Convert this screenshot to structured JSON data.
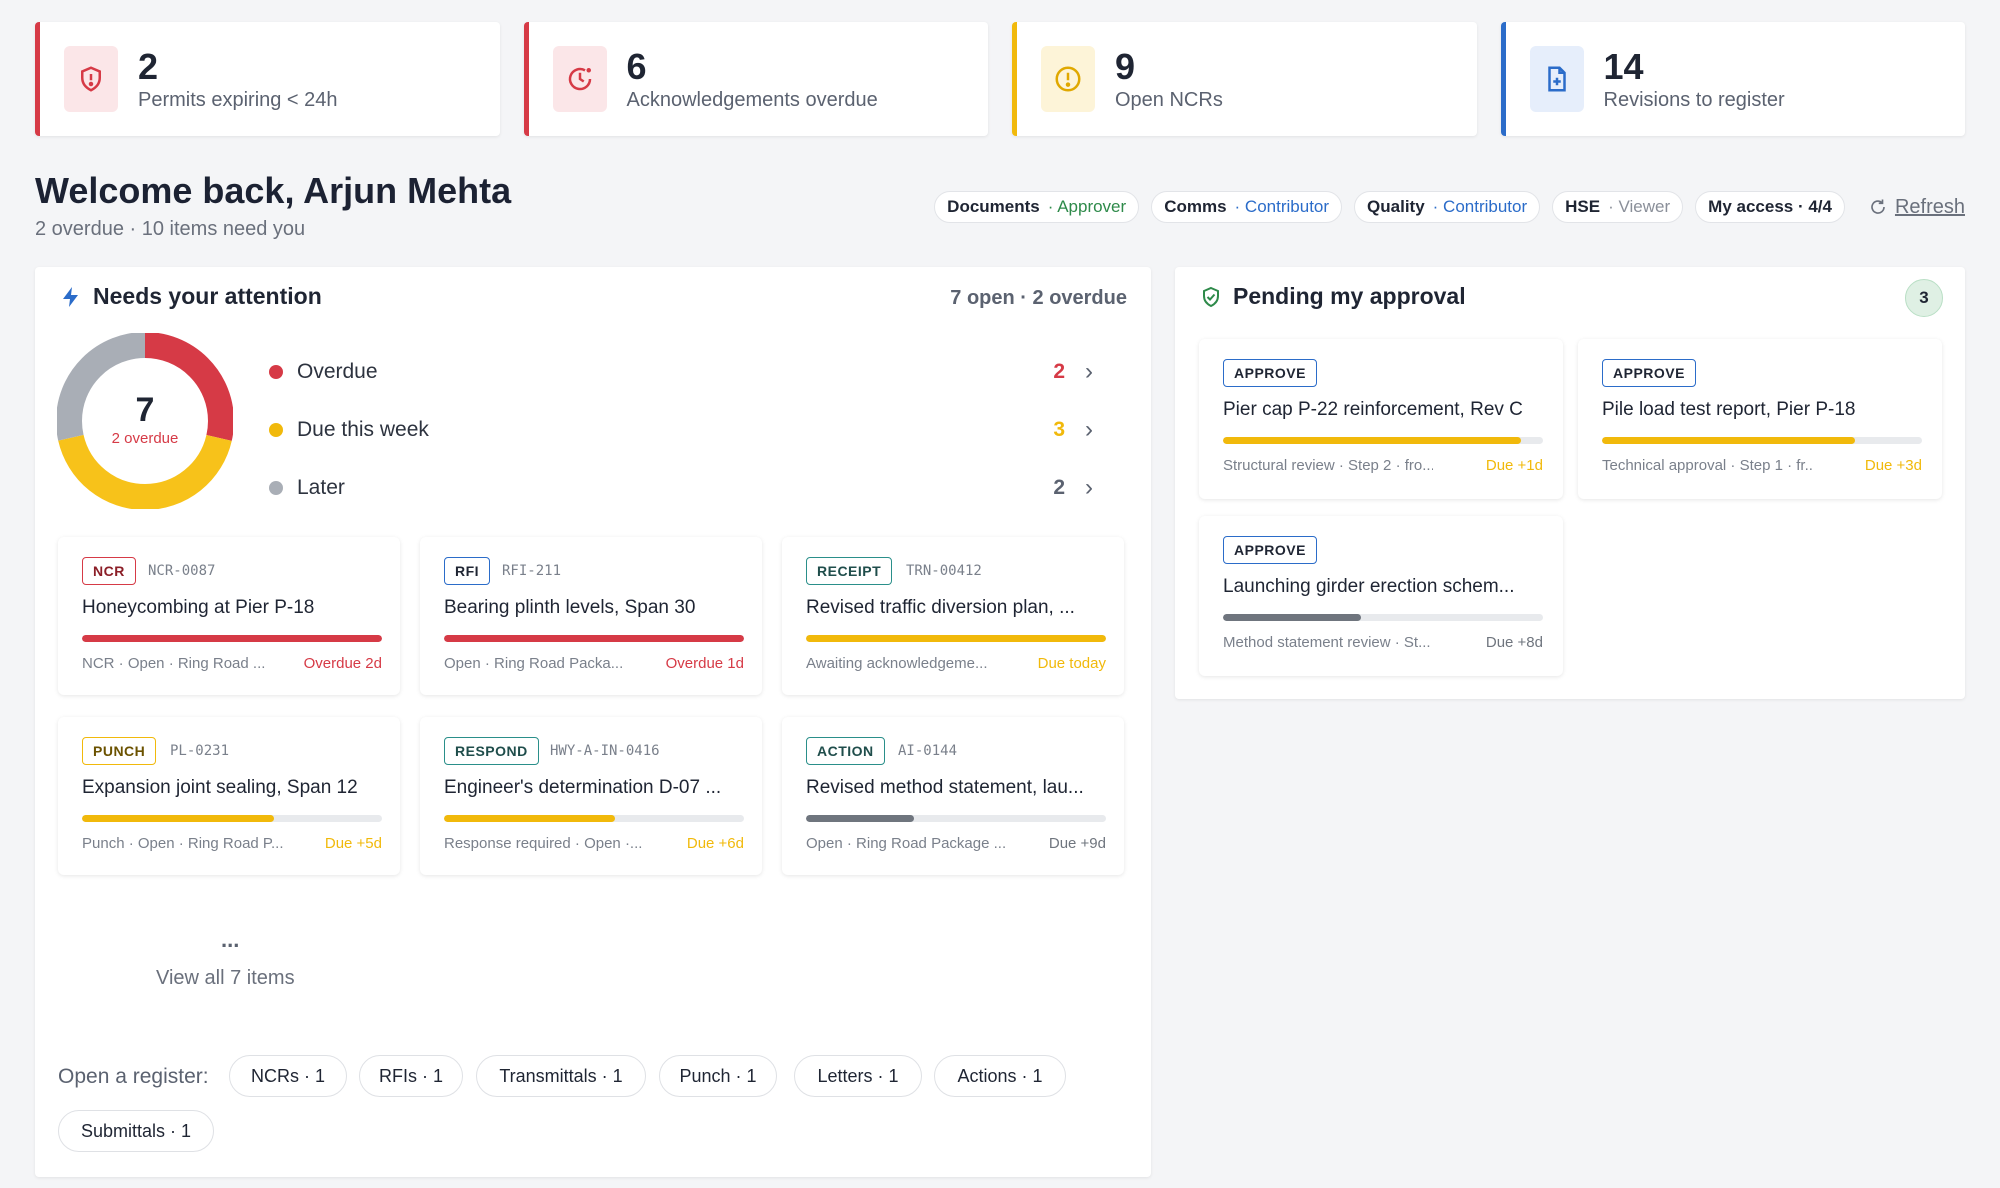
{
  "kpis": [
    {
      "value": "2",
      "label": "Permits expiring < 24h",
      "color": "#d63a46",
      "icon": "shield-alert-icon"
    },
    {
      "value": "6",
      "label": "Acknowledgements overdue",
      "color": "#d63a46",
      "icon": "clock-alert-icon"
    },
    {
      "value": "9",
      "label": "Open NCRs",
      "color": "#f1b90b",
      "icon": "alert-circle-icon"
    },
    {
      "value": "14",
      "label": "Revisions to register",
      "color": "#2b6cc9",
      "icon": "file-plus-icon"
    }
  ],
  "welcome": {
    "title": "Welcome back, Arjun Mehta",
    "subtitle": "2 overdue · 10 items need you"
  },
  "access": {
    "pills": [
      {
        "module": "Documents",
        "role": "· Approver"
      },
      {
        "module": "Comms",
        "role": "· Contributor"
      },
      {
        "module": "Quality",
        "role": "· Contributor"
      },
      {
        "module": "HSE",
        "role": "· Viewer"
      }
    ],
    "my_access": "My access · 4/4",
    "refresh": "Refresh"
  },
  "attention": {
    "title": "Needs your attention",
    "meta": "7 open · 2 overdue",
    "donut": {
      "total": "7",
      "sub": "2 overdue",
      "segments": [
        {
          "value": 2,
          "color": "#d63a46"
        },
        {
          "value": 3,
          "color": "#f7c21a"
        },
        {
          "value": 2,
          "color": "#a9aeb6"
        }
      ]
    },
    "legend": [
      {
        "label": "Overdue",
        "value": "2",
        "color": "#d63a46"
      },
      {
        "label": "Due this week",
        "value": "3",
        "color": "#f1b90b"
      },
      {
        "label": "Later",
        "value": "2",
        "color": "#a9aeb6"
      }
    ],
    "cards": [
      {
        "tag": "NCR",
        "code": "NCR-0087",
        "title": "Honeycombing at Pier P-18",
        "meta": "NCR · Open · Ring Road ...",
        "due": "Overdue 2d",
        "progress": 1.0,
        "tone": "red"
      },
      {
        "tag": "RFI",
        "code": "RFI-211",
        "title": "Bearing plinth levels, Span 30",
        "meta": "Open · Ring Road Packa...",
        "due": "Overdue 1d",
        "progress": 1.0,
        "tone": "red"
      },
      {
        "tag": "RECEIPT",
        "code": "TRN-00412",
        "title": "Revised traffic diversion plan, ...",
        "meta": "Awaiting acknowledgeme...",
        "due": "Due today",
        "progress": 1.0,
        "tone": "yellow"
      },
      {
        "tag": "PUNCH",
        "code": "PL-0231",
        "title": "Expansion joint sealing, Span 12",
        "meta": "Punch · Open · Ring Road P...",
        "due": "Due +5d",
        "progress": 0.64,
        "tone": "yellow"
      },
      {
        "tag": "RESPOND",
        "code": "HWY-A-IN-0416",
        "title": "Engineer's determination D-07 ...",
        "meta": "Response required · Open ·...",
        "due": "Due +6d",
        "progress": 0.57,
        "tone": "yellow"
      },
      {
        "tag": "ACTION",
        "code": "AI-0144",
        "title": "Revised method statement, lau...",
        "meta": "Open · Ring Road Package ...",
        "due": "Due +9d",
        "progress": 0.36,
        "tone": "gray"
      }
    ],
    "more": "...",
    "view_all": "View all 7 items",
    "register_label": "Open a register:",
    "registers": [
      "NCRs · 1",
      "RFIs · 1",
      "Transmittals · 1",
      "Punch · 1",
      "Letters · 1",
      "Actions · 1",
      "Submittals · 1"
    ]
  },
  "approval": {
    "title": "Pending my approval",
    "count": "3",
    "cards": [
      {
        "tag": "APPROVE",
        "title": "Pier cap P-22 reinforcement, Rev C",
        "meta": "Structural review · Step 2 · fro...",
        "due": "Due +1d",
        "progress": 0.93,
        "tone": "yellow"
      },
      {
        "tag": "APPROVE",
        "title": "Pile load test report, Pier P-18",
        "meta": "Technical approval · Step 1 · fr...",
        "due": "Due +3d",
        "progress": 0.79,
        "tone": "yellow"
      },
      {
        "tag": "APPROVE",
        "title": "Launching girder erection schem...",
        "meta": "Method statement review · St...",
        "due": "Due +8d",
        "progress": 0.43,
        "tone": "gray"
      }
    ]
  },
  "colors": {
    "red": "#d63a46",
    "yellow": "#f1b90b",
    "gray": "#6f757e",
    "blue": "#2b6cc9",
    "green": "#2e8a4a"
  }
}
